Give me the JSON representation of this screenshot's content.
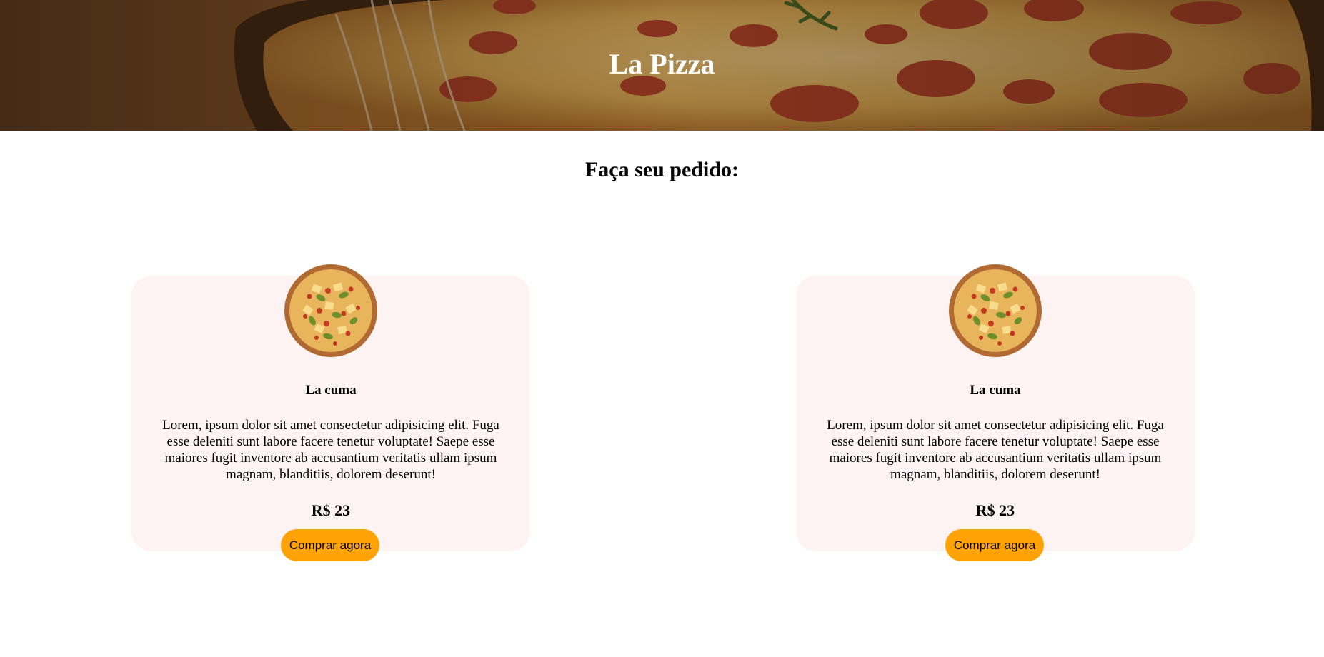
{
  "hero": {
    "title": "La Pizza"
  },
  "order_section": {
    "heading": "Faça seu pedido:"
  },
  "products": [
    {
      "image": "pizza-icon",
      "name": "La cuma",
      "description": "Lorem, ipsum dolor sit amet consectetur adipisicing elit. Fuga esse deleniti sunt labore facere tenetur voluptate! Saepe esse maiores fugit inventore ab accusantium veritatis ullam ipsum magnam, blanditiis, dolorem deserunt!",
      "price": "R$ 23",
      "button_label": "Comprar agora"
    },
    {
      "image": "pizza-icon",
      "name": "La cuma",
      "description": "Lorem, ipsum dolor sit amet consectetur adipisicing elit. Fuga esse deleniti sunt labore facere tenetur voluptate! Saepe esse maiores fugit inventore ab accusantium veritatis ullam ipsum magnam, blanditiis, dolorem deserunt!",
      "price": "R$ 23",
      "button_label": "Comprar agora"
    }
  ],
  "colors": {
    "button": "#ffa205",
    "card_background": "#fdf3f2",
    "hero_overlay": "#3a2412"
  }
}
